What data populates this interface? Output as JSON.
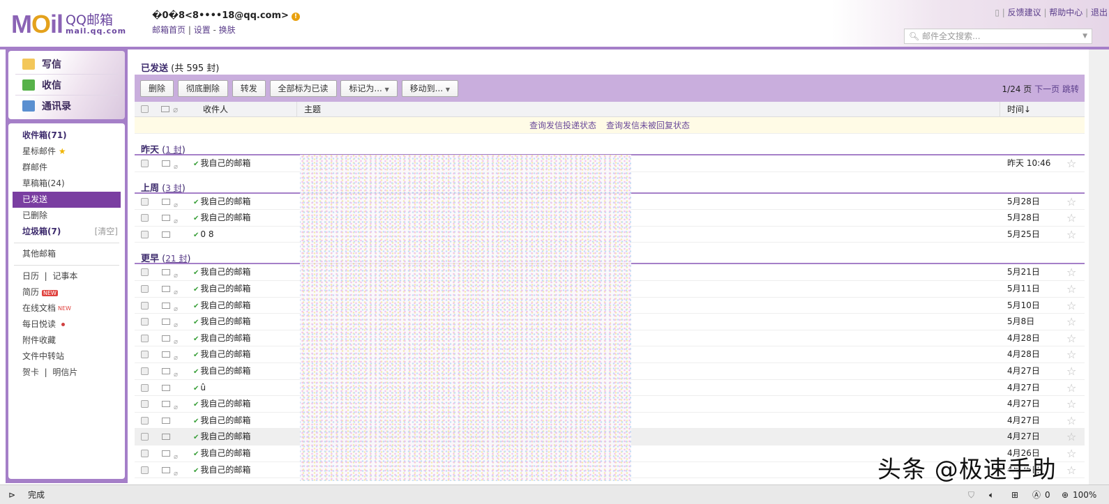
{
  "header": {
    "logo_text": "MOil",
    "brand_name": "QQ邮箱",
    "brand_url": "mail.qq.com",
    "account": "�0�8<8••••18@qq.com>",
    "links": [
      "邮箱首页",
      "设置",
      "换肤"
    ],
    "top_links": [
      "反馈建议",
      "帮助中心",
      "退出"
    ],
    "search_placeholder": "邮件全文搜索..."
  },
  "sidebar": {
    "quick": [
      "写信",
      "收信",
      "通讯录"
    ],
    "folders": [
      {
        "label": "收件箱(71)",
        "bold": true
      },
      {
        "label": "星标邮件"
      },
      {
        "label": "群邮件"
      },
      {
        "label": "草稿箱(24)"
      },
      {
        "label": "已发送",
        "selected": true
      },
      {
        "label": "已删除"
      },
      {
        "label": "垃圾箱(7)",
        "bold": true,
        "action": "[清空]"
      }
    ],
    "other": "其他邮箱",
    "apps": {
      "calendar": "日历",
      "notes": "记事本",
      "resume": "简历",
      "docs": "在线文档",
      "daily": "每日悦读",
      "attach": "附件收藏",
      "transfer": "文件中转站",
      "card": "贺卡",
      "postcard": "明信片",
      "new_badge": "NEW"
    }
  },
  "main": {
    "title": "已发送",
    "count": "(共 595 封)",
    "toolbar": [
      "删除",
      "彻底删除",
      "转发",
      "全部标为已读",
      "标记为...",
      "移动到..."
    ],
    "pager": {
      "page": "1/24 页",
      "next": "下一页",
      "jump": "跳转"
    },
    "columns": {
      "recipient": "收件人",
      "subject": "主题",
      "time": "时间↓"
    },
    "notice": [
      "查询发信投递状态",
      "查询发信未被回复状态"
    ],
    "groups": [
      {
        "label": "昨天",
        "count": "1 封",
        "rows": [
          {
            "to": "我自己的邮箱",
            "date": "昨天 10:46",
            "attach": true
          }
        ]
      },
      {
        "label": "上周",
        "count": "3 封",
        "rows": [
          {
            "to": "我自己的邮箱",
            "date": "5月28日",
            "attach": true
          },
          {
            "to": "我自己的邮箱",
            "date": "5月28日",
            "attach": true
          },
          {
            "to": "0 8",
            "date": "5月25日"
          }
        ]
      },
      {
        "label": "更早",
        "count": "21 封",
        "rows": [
          {
            "to": "我自己的邮箱",
            "date": "5月21日",
            "attach": true
          },
          {
            "to": "我自己的邮箱",
            "date": "5月11日",
            "attach": true
          },
          {
            "to": "我自己的邮箱",
            "date": "5月10日",
            "attach": true
          },
          {
            "to": "我自己的邮箱",
            "date": "5月8日",
            "attach": true
          },
          {
            "to": "我自己的邮箱",
            "date": "4月28日",
            "attach": true
          },
          {
            "to": "我自己的邮箱",
            "date": "4月28日",
            "attach": true
          },
          {
            "to": "我自己的邮箱",
            "date": "4月27日",
            "attach": true
          },
          {
            "to": "û",
            "date": "4月27日"
          },
          {
            "to": "我自己的邮箱",
            "date": "4月27日",
            "attach": true
          },
          {
            "to": "我自己的邮箱",
            "date": "4月27日"
          },
          {
            "to": "我自己的邮箱",
            "date": "4月27日",
            "highlight": true
          },
          {
            "to": "我自己的邮箱",
            "date": "4月26日",
            "attach": true
          },
          {
            "to": "我自己的邮箱",
            "date": "4月26日",
            "attach": true
          }
        ]
      }
    ]
  },
  "status": {
    "text": "完成",
    "ad_count": "0",
    "zoom": "100%"
  },
  "watermark": "头条 @极速手助",
  "colors": {
    "accent": "#a57fc8",
    "selected": "#7a3ea1",
    "toolbar": "#c9aedd"
  }
}
